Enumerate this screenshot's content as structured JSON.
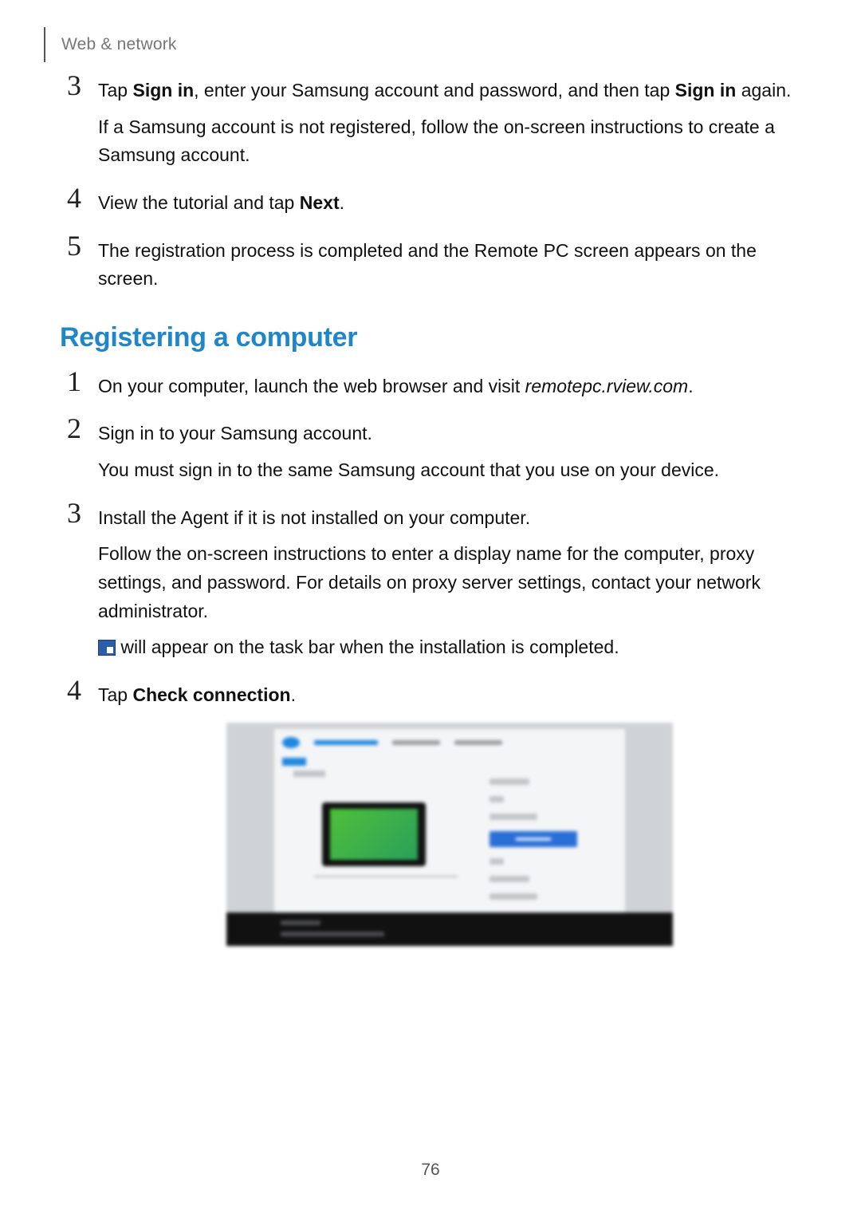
{
  "header": {
    "breadcrumb": "Web & network"
  },
  "stepsA": {
    "3": {
      "num": "3",
      "s1a": "Tap ",
      "s1b": "Sign in",
      "s1c": ", enter your Samsung account and password, and then tap ",
      "s1d": "Sign in",
      "s1e": " again.",
      "s2": "If a Samsung account is not registered, follow the on-screen instructions to create a Samsung account."
    },
    "4": {
      "num": "4",
      "s1a": "View the tutorial and tap ",
      "s1b": "Next",
      "s1c": "."
    },
    "5": {
      "num": "5",
      "s1": "The registration process is completed and the Remote PC screen appears on the screen."
    }
  },
  "section_title": "Registering a computer",
  "stepsB": {
    "1": {
      "num": "1",
      "s1a": "On your computer, launch the web browser and visit ",
      "s1b": "remotepc.rview.com",
      "s1c": "."
    },
    "2": {
      "num": "2",
      "s1": "Sign in to your Samsung account.",
      "s2": "You must sign in to the same Samsung account that you use on your device."
    },
    "3": {
      "num": "3",
      "s1": "Install the Agent if it is not installed on your computer.",
      "s2": "Follow the on-screen instructions to enter a display name for the computer, proxy settings, and password. For details on proxy server settings, contact your network administrator.",
      "s3": " will appear on the task bar when the installation is completed."
    },
    "4": {
      "num": "4",
      "s1a": "Tap ",
      "s1b": "Check connection",
      "s1c": "."
    }
  },
  "page_number": "76"
}
